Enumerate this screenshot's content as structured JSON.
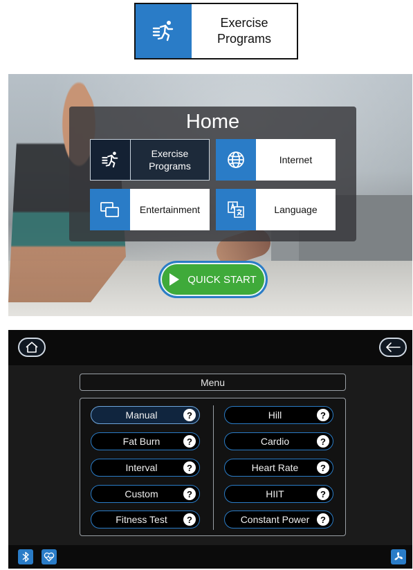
{
  "top_tile": {
    "icon": "runner-icon",
    "label_line1": "Exercise",
    "label_line2": "Programs"
  },
  "home": {
    "title": "Home",
    "tiles": [
      {
        "icon": "runner-icon",
        "line1": "Exercise",
        "line2": "Programs"
      },
      {
        "icon": "globe-icon",
        "label": "Internet"
      },
      {
        "icon": "screens-icon",
        "label": "Entertainment"
      },
      {
        "icon": "translate-icon",
        "label": "Language"
      }
    ],
    "quick_start": "QUICK START"
  },
  "menu": {
    "title": "Menu",
    "help_glyph": "?",
    "left": [
      "Manual",
      "Fat Burn",
      "Interval",
      "Custom",
      "Fitness Test"
    ],
    "right": [
      "Hill",
      "Cardio",
      "Heart Rate",
      "HIIT",
      "Constant Power"
    ]
  },
  "colors": {
    "accent": "#2a7cc7",
    "go": "#3faa3a",
    "dark": "#1b1b1b"
  }
}
